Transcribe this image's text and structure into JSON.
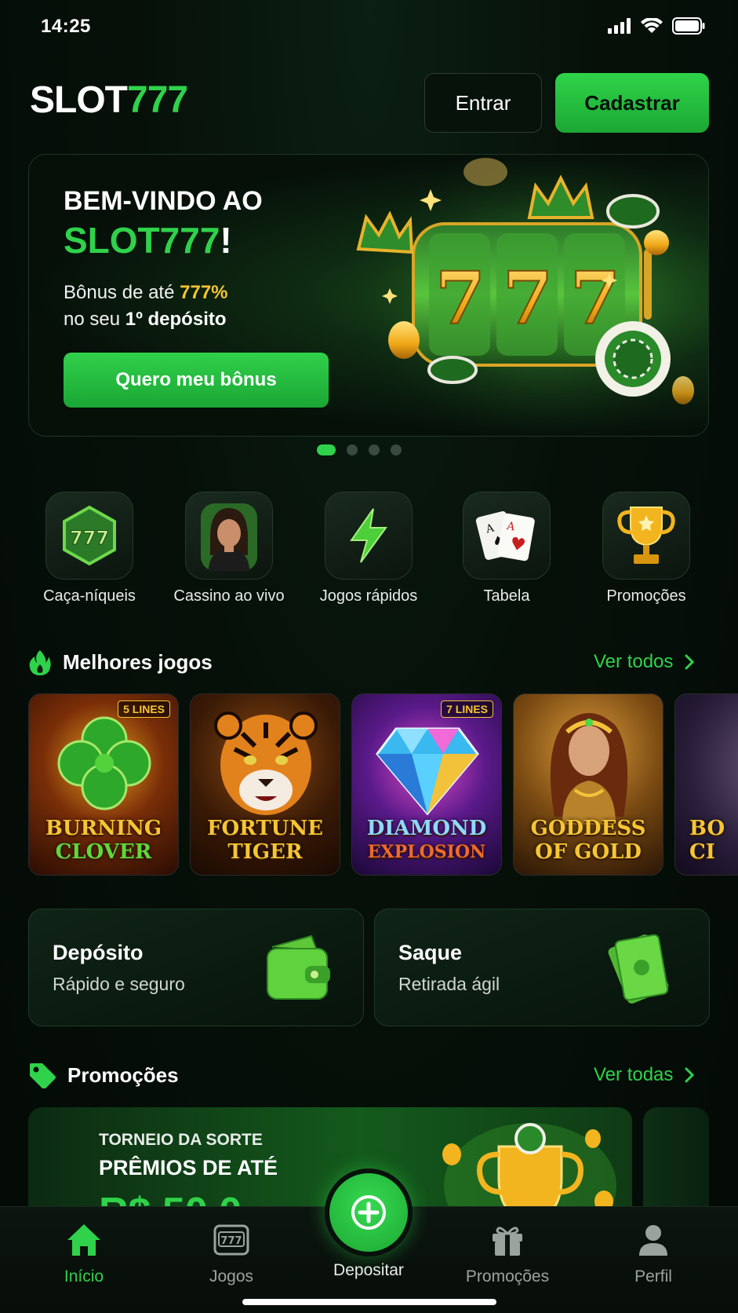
{
  "status": {
    "time": "14:25"
  },
  "header": {
    "logo_part1": "SLOT",
    "logo_part2": "777",
    "login_label": "Entrar",
    "signup_label": "Cadastrar"
  },
  "hero": {
    "title_line1": "BEM-VINDO AO",
    "title_brand": "SLOT777",
    "title_excl": "!",
    "sub_prefix": "Bônus de até ",
    "sub_highlight": "777%",
    "sub2_prefix": "no seu ",
    "sub2_bold": "1º depósito",
    "cta_label": "Quero meu bônus",
    "slides_count": 4,
    "active_slide": 1
  },
  "categories": [
    {
      "label": "Caça-níqueis",
      "icon": "slot-777-icon"
    },
    {
      "label": "Cassino ao vivo",
      "icon": "live-dealer-icon"
    },
    {
      "label": "Jogos rápidos",
      "icon": "lightning-icon"
    },
    {
      "label": "Tabela",
      "icon": "playing-cards-icon"
    },
    {
      "label": "Promoções",
      "icon": "trophy-icon"
    }
  ],
  "best_games": {
    "title": "Melhores jogos",
    "link": "Ver todos",
    "games": [
      {
        "line1": "BURNING",
        "line2": "CLOVER",
        "badge": "5 LINES"
      },
      {
        "line1": "FORTUNE",
        "line2": "TIGER",
        "badge": ""
      },
      {
        "line1": "DIAMOND",
        "line2": "EXPLOSION",
        "badge": "7 LINES"
      },
      {
        "line1": "GODDESS",
        "line2": "OF GOLD",
        "badge": ""
      },
      {
        "line1": "BO",
        "line2": "CI",
        "badge": ""
      }
    ]
  },
  "transactions": {
    "deposit_title": "Depósito",
    "deposit_sub": "Rápido e seguro",
    "withdraw_title": "Saque",
    "withdraw_sub": "Retirada ágil"
  },
  "promotions": {
    "title": "Promoções",
    "link": "Ver todas",
    "banner_line1": "TORNEIO DA SORTE",
    "banner_line2": "PRÊMIOS DE ATÉ",
    "banner_amount": "R$ 50.0"
  },
  "bottom_nav": {
    "home": "Início",
    "games": "Jogos",
    "deposit": "Depositar",
    "promos": "Promoções",
    "profile": "Perfil"
  },
  "colors": {
    "accent": "#2fd24a",
    "gold": "#f6c533",
    "background": "#061009"
  }
}
